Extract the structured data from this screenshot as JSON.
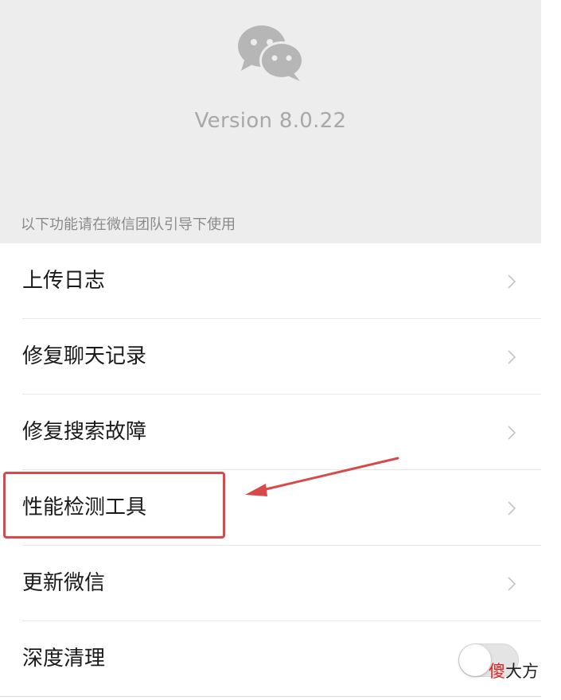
{
  "about": {
    "version_text": "Version 8.0.22",
    "section_hint": "以下功能请在微信团队引导下使用"
  },
  "menu": {
    "items": [
      {
        "label": "上传日志",
        "control": "chevron"
      },
      {
        "label": "修复聊天记录",
        "control": "chevron"
      },
      {
        "label": "修复搜索故障",
        "control": "chevron"
      },
      {
        "label": "性能检测工具",
        "control": "chevron",
        "highlighted": true
      },
      {
        "label": "更新微信",
        "control": "chevron"
      },
      {
        "label": "深度清理",
        "control": "toggle",
        "toggle_on": false
      }
    ]
  },
  "annotation": {
    "color": "#d84a4a",
    "target": "性能检测工具"
  },
  "watermark": {
    "first_char": "傻",
    "rest": "大方"
  },
  "colors": {
    "header_bg": "#ededed",
    "text": "#1a1a1a",
    "secondary_text": "#8a8a8a",
    "chevron": "#c4c4c4"
  }
}
